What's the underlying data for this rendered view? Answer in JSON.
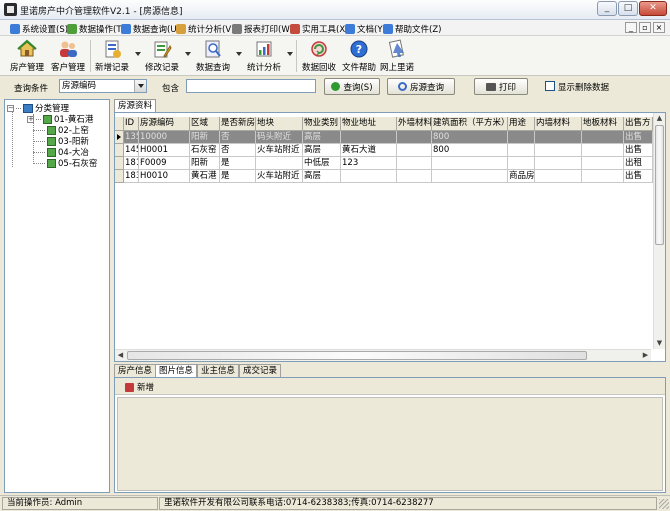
{
  "window": {
    "title": "里诺房产中介管理软件V2.1 - [房源信息]",
    "buttons": [
      "_",
      "□",
      "✕"
    ]
  },
  "menubar": {
    "items": [
      {
        "label": "系统设置(S)",
        "icon": "settings-icon",
        "color": "#3d7bd8"
      },
      {
        "label": "数据操作(T)",
        "icon": "data-icon",
        "color": "#4e9e3a"
      },
      {
        "label": "数据查询(U)",
        "icon": "query-icon",
        "color": "#3d7bd8"
      },
      {
        "label": "统计分析(V)",
        "icon": "chart-icon",
        "color": "#d8a03d"
      },
      {
        "label": "报表打印(W)",
        "icon": "print-icon",
        "color": "#7a7a7a"
      },
      {
        "label": "实用工具(X)",
        "icon": "tools-icon",
        "color": "#c44b3d"
      },
      {
        "label": "文档(Y)",
        "icon": "doc-icon",
        "color": "#3d7bd8"
      },
      {
        "label": "帮助文件(Z)",
        "icon": "help-icon",
        "color": "#3d7bd8"
      }
    ],
    "mdi_buttons": [
      "_",
      "▫",
      "×"
    ]
  },
  "toolbar": {
    "buttons": [
      {
        "label": "房产管理",
        "icon": "house-icon"
      },
      {
        "label": "客户管理",
        "icon": "users-icon"
      },
      {
        "label": "新增记录",
        "icon": "new-record-icon"
      },
      {
        "label": "修改记录",
        "icon": "edit-record-icon"
      },
      {
        "label": "数据查询",
        "icon": "search-data-icon"
      },
      {
        "label": "统计分析",
        "icon": "statistics-icon"
      },
      {
        "label": "数据回收",
        "icon": "recycle-icon"
      },
      {
        "label": "文件帮助",
        "icon": "help-icon"
      },
      {
        "label": "网上里诺",
        "icon": "web-icon"
      }
    ]
  },
  "querybar": {
    "condition_label": "查询条件",
    "condition_value": "房源编码",
    "contains_label": "包含",
    "contains_value": "",
    "query_button": "查询(S)",
    "house_query_button": "房源查询",
    "print_button": "打印",
    "show_deleted_label": "显示删除数据",
    "show_deleted_checked": false
  },
  "tree": {
    "root": "分类管理",
    "children": [
      "01-黄石港",
      "02-上窑",
      "03-阳新",
      "04-大冶",
      "05-石灰窑"
    ]
  },
  "grid": {
    "tab": "房源资料",
    "columns": [
      "ID",
      "房源编码",
      "区域",
      "是否新房",
      "地块",
      "物业类别",
      "物业地址",
      "外墙材料",
      "建筑面积（平方米）",
      "用途",
      "内墙材料",
      "地板材料",
      "出售方"
    ],
    "rows": [
      {
        "selected": true,
        "cells": [
          "135",
          "10000",
          "阳新",
          "否",
          "码头附近",
          "高层",
          "",
          "",
          "800",
          "",
          "",
          "",
          "出售"
        ]
      },
      {
        "selected": false,
        "cells": [
          "145",
          "H0001",
          "石灰窑",
          "否",
          "火车站附近",
          "高层",
          "黄石大道",
          "",
          "800",
          "",
          "",
          "",
          "出售"
        ]
      },
      {
        "selected": false,
        "cells": [
          "181",
          "F0009",
          "阳新",
          "是",
          "",
          "中低层",
          "123",
          "",
          "",
          "",
          "",
          "",
          "出租"
        ]
      },
      {
        "selected": false,
        "cells": [
          "183",
          "H0010",
          "黄石港",
          "是",
          "火车站附近",
          "高层",
          "",
          "",
          "",
          "商品房",
          "",
          "",
          "出售"
        ]
      }
    ]
  },
  "bottom_tabs": {
    "tabs": [
      "房产信息",
      "图片信息",
      "业主信息",
      "成交记录"
    ],
    "active_index": 1,
    "add_label": "新增"
  },
  "statusbar": {
    "operator": "当前操作员: Admin",
    "company": "里诺软件开发有限公司联系电话:0714-6238383;传真:0714-6238277"
  }
}
